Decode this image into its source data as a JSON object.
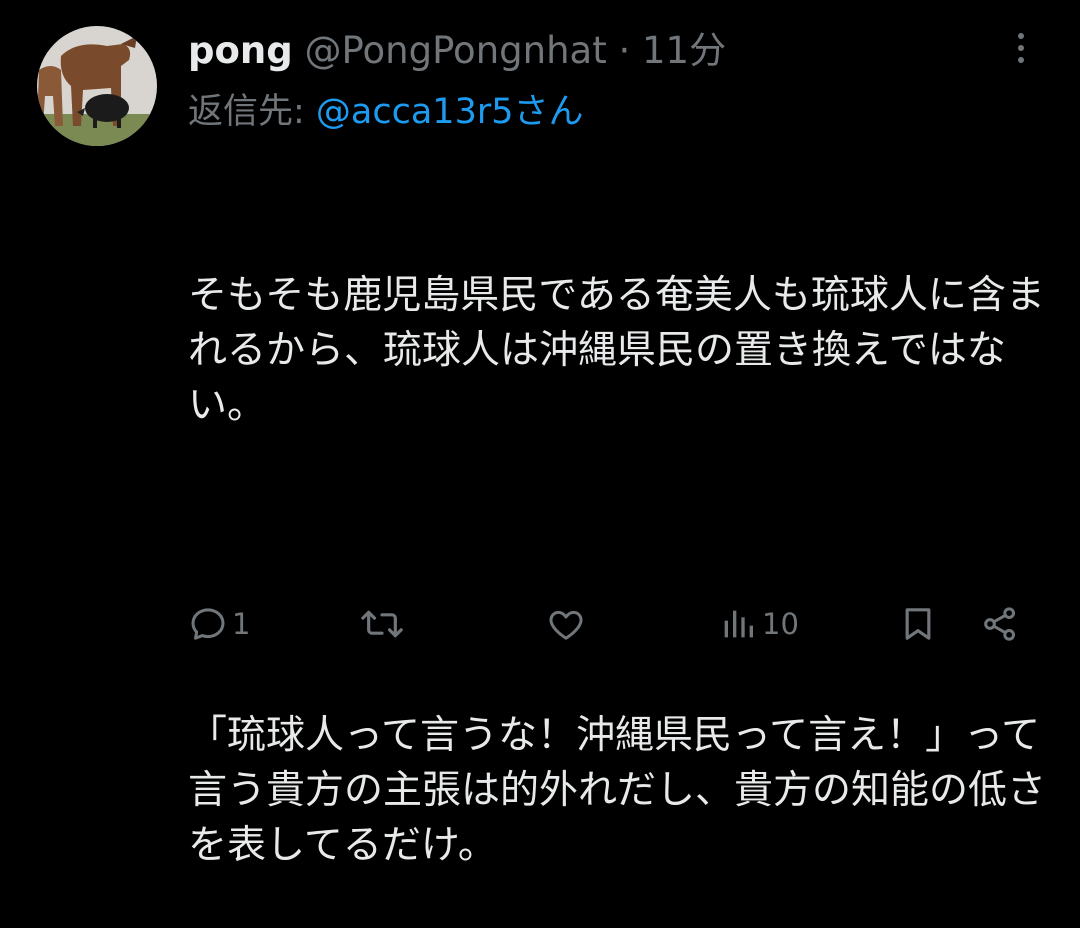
{
  "tweet": {
    "display_name": "pong",
    "handle": "@PongPongnhat",
    "separator": "·",
    "time": "11分",
    "reply_prefix": "返信先: ",
    "reply_to": "@acca13r5さん",
    "text_paragraph_1": "そもそも鹿児島県民である奄美人も琉球人に含まれるから、琉球人は沖縄県民の置き換えではない。",
    "text_paragraph_2": "「琉球人って言うな！沖縄県民って言え！」って言う貴方の主張は的外れだし、貴方の知能の低さを表してるだけ。"
  },
  "actions": {
    "reply_count": "1",
    "retweet_count": "",
    "like_count": "",
    "views_count": "10"
  },
  "icons": {
    "avatar": "avatar-cattle-boar-photo",
    "more": "more-vertical-icon",
    "reply": "reply-icon",
    "retweet": "retweet-icon",
    "like": "heart-icon",
    "views": "views-bar-chart-icon",
    "bookmark": "bookmark-icon",
    "share": "share-icon"
  },
  "colors": {
    "background": "#000000",
    "text": "#e7e9ea",
    "secondary": "#71767b",
    "link": "#1d9bf0"
  }
}
